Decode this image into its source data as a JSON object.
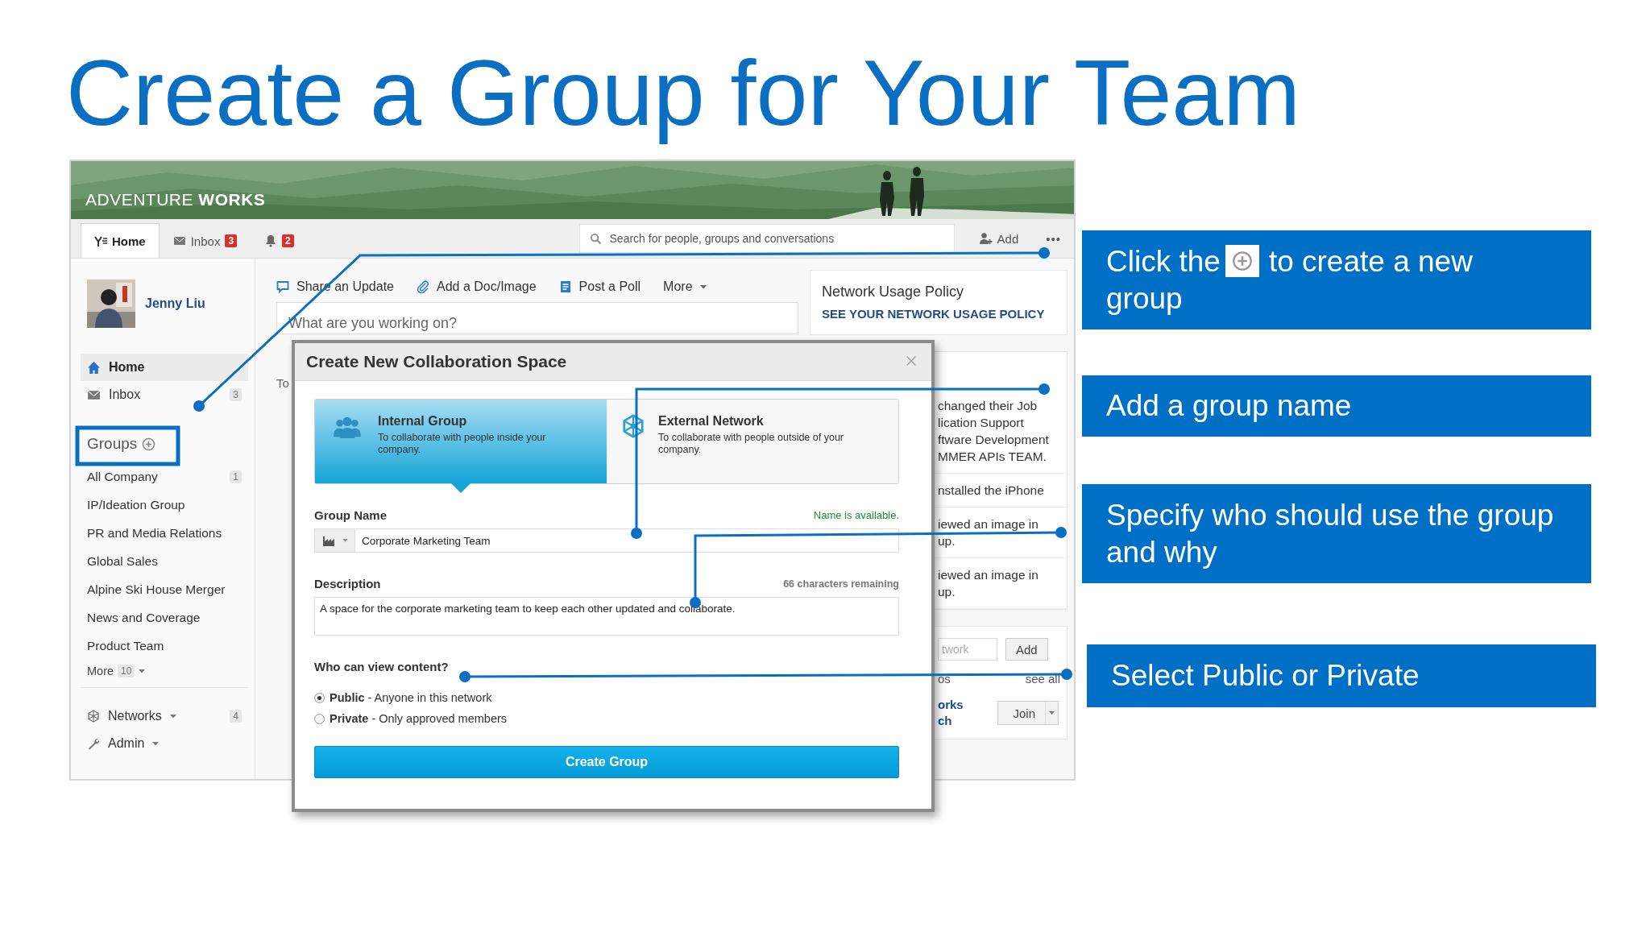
{
  "slide": {
    "title": "Create a Group for Your Team"
  },
  "app": {
    "logo": "ADVENTURE **WORKS**",
    "nav_tabs": [
      {
        "kind": "home",
        "label": "Home",
        "selected": true
      },
      {
        "kind": "inbox",
        "label": "Inbox",
        "badge": "3",
        "selected": false
      },
      {
        "kind": "notifications",
        "badge": "2",
        "selected": false
      }
    ],
    "search": {
      "placeholder": "Search for people, groups and conversations"
    },
    "add_button": "Add",
    "more_button": "•••",
    "user": {
      "name": "Jenny Liu"
    },
    "sidebar": {
      "items": [
        {
          "kind": "home",
          "label": "Home",
          "selected": true
        },
        {
          "kind": "inbox",
          "label": "Inbox",
          "count": "3",
          "selected": false
        }
      ],
      "groups_heading": "Groups",
      "groups": [
        {
          "label": "All Company",
          "count": "1"
        },
        {
          "label": "IP/Ideation Group"
        },
        {
          "label": "PR and Media Relations"
        },
        {
          "label": "Global Sales"
        },
        {
          "label": "Alpine Ski House Merger"
        },
        {
          "label": "News and Coverage"
        },
        {
          "label": "Product Team"
        }
      ],
      "more": {
        "label": "More",
        "count": "10"
      },
      "footer_items": [
        {
          "kind": "networks",
          "label": "Networks",
          "count": "4"
        },
        {
          "kind": "admin",
          "label": "Admin"
        }
      ]
    },
    "publisher": {
      "actions": [
        {
          "kind": "update",
          "label": "Share an Update"
        },
        {
          "kind": "file",
          "label": "Add a Doc/Image"
        },
        {
          "kind": "poll",
          "label": "Post a Poll"
        },
        {
          "kind": "menu",
          "label": "More"
        }
      ],
      "placeholder": "What are you working on?",
      "tab_fragment": "To"
    },
    "policy": {
      "title": "Network Usage Policy",
      "link": "SEE YOUR NETWORK USAGE POLICY"
    },
    "activity": [
      {
        "lines": [
          "changed their Job",
          "lication Support",
          "ftware Development",
          "MMER APIs TEAM."
        ]
      },
      {
        "lines": [
          "nstalled the iPhone"
        ]
      },
      {
        "lines": [
          "iewed an image in",
          "up."
        ]
      },
      {
        "lines": [
          "iewed an image in",
          "up."
        ]
      }
    ],
    "invite": {
      "placeholder": "twork",
      "button": "Add"
    },
    "suggested": {
      "heading": "os",
      "see_all": "see all",
      "lines": [
        "orks",
        "ch"
      ],
      "button": "Join"
    }
  },
  "dialog": {
    "title": "Create New Collaboration Space",
    "options": [
      {
        "kind": "internal",
        "title": "Internal Group",
        "text": "To collaborate with people inside your company.",
        "selected": true
      },
      {
        "kind": "external",
        "title": "External Network",
        "text": "To collaborate with people outside of your company.",
        "selected": false
      }
    ],
    "name_label": "Group Name",
    "name_status": "Name is available.",
    "name_value": "Corporate Marketing Team",
    "description_label": "Description",
    "description_remaining": "66 characters remaining",
    "description_value": "A space for the corporate marketing team to keep each other updated and collaborate.",
    "visibility_label": "Who can view content?",
    "visibility": [
      {
        "label": "Public",
        "text": " - Anyone in this network",
        "selected": true
      },
      {
        "label": "Private",
        "text": " - Only approved members",
        "selected": false
      }
    ],
    "submit": "Create Group"
  },
  "callouts": [
    {
      "kind": "icon",
      "before": "Click the",
      "after": "to create a new group"
    },
    {
      "kind": "text",
      "text": "Add a group name"
    },
    {
      "kind": "text",
      "text": "Specify who should use the group and why"
    },
    {
      "kind": "text",
      "text": "Select Public or Private"
    }
  ]
}
